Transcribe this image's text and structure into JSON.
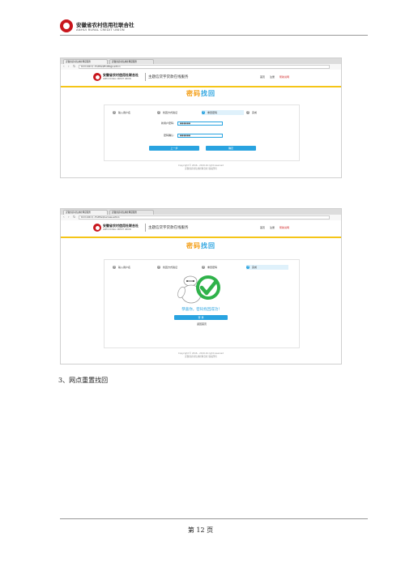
{
  "doc_header": {
    "brand_cn": "安徽省农村信用社联合社",
    "brand_en": "ANHUI RURAL CREDIT UNION"
  },
  "screenshot1": {
    "tabs": [
      "安徽省农村信用社网贷服务",
      "安徽省农村信用社网贷服务"
    ],
    "url": "10.0.140.1/...findPwd/findPage.action",
    "site": {
      "brand_cn": "安徽省农村信用社联合社",
      "brand_en": "ANHUI RURAL CREDIT UNION",
      "subtitle": "主题信贷字贷款在线服务",
      "links": [
        "首页",
        "注册",
        "帮助说明"
      ]
    },
    "title_a": "密码",
    "title_b": "找回",
    "steps": [
      {
        "num": "1",
        "label": "输入用户名"
      },
      {
        "num": "2",
        "label": "找回方式验证"
      },
      {
        "num": "3",
        "label": "重置密码"
      },
      {
        "num": "4",
        "label": "完成"
      }
    ],
    "active_step": 3,
    "fields": [
      {
        "label": "新用户密码:",
        "value": "●●●●●●"
      },
      {
        "label": "密码确认:",
        "value": "●●●●●●"
      }
    ],
    "buttons": {
      "prev": "上一步",
      "confirm": "确定"
    },
    "copyright": [
      "Copyright © 2016 - 2019 All right reserved",
      "安徽省农村信用社联合社 版权所有"
    ]
  },
  "screenshot2": {
    "tabs": [
      "安徽省农村信用社网贷服务",
      "安徽省农村信用社网贷服务"
    ],
    "url": "10.0.140.1/...findPwd/success.action",
    "site": {
      "brand_cn": "安徽省农村信用社联合社",
      "brand_en": "ANHUI RURAL CREDIT UNION",
      "subtitle": "主题信贷字贷款在线服务",
      "links": [
        "首页",
        "注册",
        "帮助说明"
      ]
    },
    "title_a": "密码",
    "title_b": "找回",
    "steps": [
      {
        "num": "1",
        "label": "输入用户名"
      },
      {
        "num": "2",
        "label": "找回方式验证"
      },
      {
        "num": "3",
        "label": "重置密码"
      },
      {
        "num": "4",
        "label": "完成"
      }
    ],
    "active_step": 4,
    "success_text": "恭喜你，密码找回成功！",
    "buttons": {
      "login": "登 录"
    },
    "back_link": "返回首页",
    "copyright": [
      "Copyright © 2016 - 2019 All right reserved",
      "安徽省农村信用社联合社 版权所有"
    ]
  },
  "section_title": "3、网点重置找回",
  "page_label": "第 12 页",
  "colors": {
    "accent": "#29a3e0",
    "brand_red": "#c8161d",
    "title_orange": "#f39c12",
    "header_rule": "#f5c518",
    "success_green": "#2fb24a"
  }
}
